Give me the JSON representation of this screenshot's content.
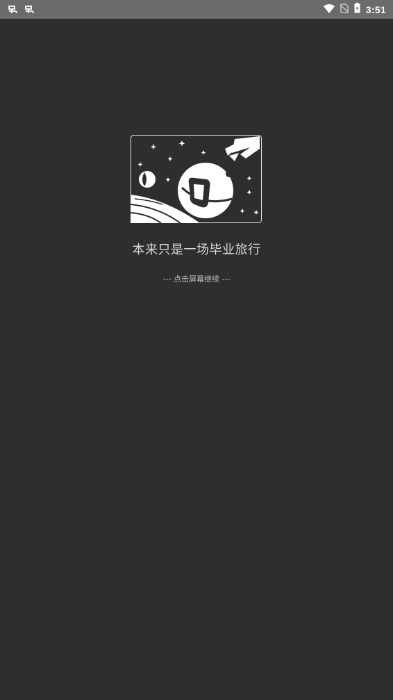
{
  "status_bar": {
    "notification_icons": [
      "bug-icon",
      "bug-icon"
    ],
    "system_icons": [
      "wifi-icon",
      "no-sim-icon",
      "battery-charging-icon"
    ],
    "time": "3:51"
  },
  "splash": {
    "illustration_icon": "space-planet-illustration",
    "title": "本来只是一场毕业旅行",
    "hint": "--- 点击屏幕继续 ---"
  },
  "colors": {
    "background": "#2e2e2e",
    "status_bar": "#6b6b6b",
    "title_text": "#d8d8d8",
    "hint_text": "#bdbdbd"
  }
}
